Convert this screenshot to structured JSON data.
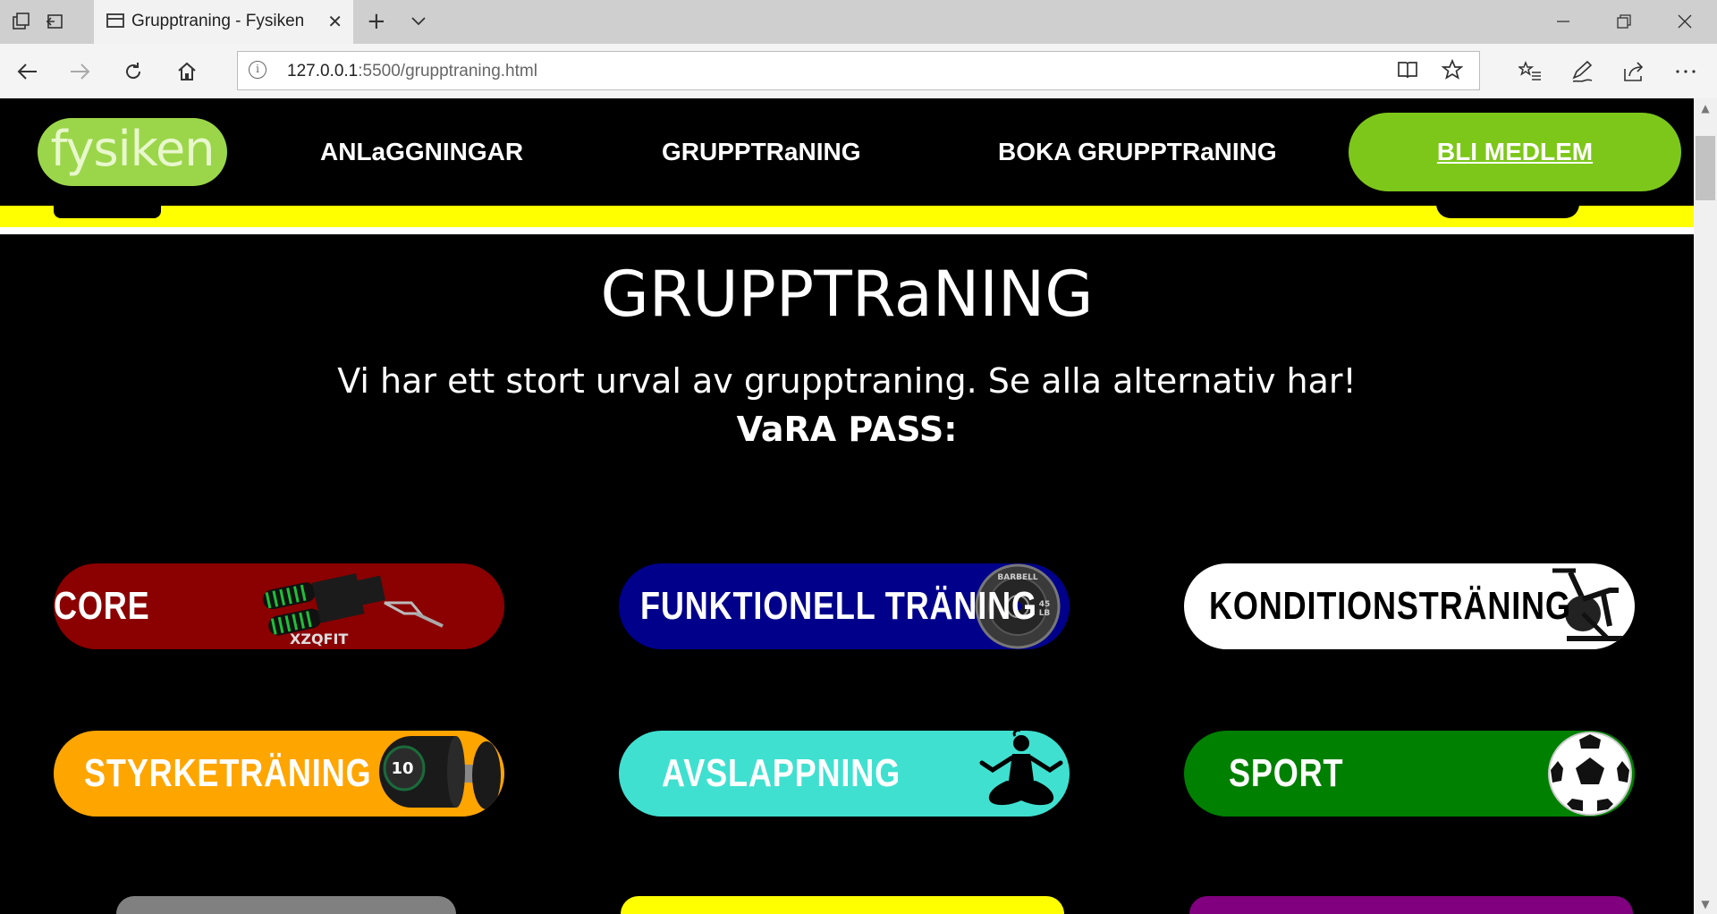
{
  "browser": {
    "tab_title": "Grupptraning - Fysiken",
    "tab_close": "✕",
    "new_tab": "+",
    "url_host": "127.0.0.1",
    "url_path": ":5500/grupptraning.html"
  },
  "site": {
    "logo_text": "fysiken",
    "nav": [
      {
        "label": "ANLaGGNINGAR"
      },
      {
        "label": "GRUPPTRaNING"
      },
      {
        "label": "BOKA GRUPPTRaNING"
      }
    ],
    "cta_label": "BLI MEDLEM"
  },
  "main": {
    "title": "GRUPPTRaNING",
    "intro": "Vi har ett stort urval av grupptraning. Se alla alternativ har!",
    "subhead": "VaRA PASS:"
  },
  "passes": [
    {
      "label": "CORE",
      "bg": "#8b0000",
      "color": "#ffffff",
      "icon": "hand-grip-icon",
      "img_text": "XZQFIT"
    },
    {
      "label": "FUNKTIONELL TRÄNING",
      "bg": "#00008b",
      "color": "#ffffff",
      "icon": "barbell-plate-icon",
      "img_text": "BARBELL"
    },
    {
      "label": "KONDITIONSTRÄNING",
      "bg": "#ffffff",
      "color": "#000000",
      "icon": "exercise-bike-icon"
    },
    {
      "label": "STYRKETRÄNING",
      "bg": "#ffa500",
      "color": "#ffffff",
      "icon": "dumbbell-icon",
      "img_text": "10"
    },
    {
      "label": "AVSLAPPNING",
      "bg": "#40e0d0",
      "color": "#ffffff",
      "icon": "meditation-icon"
    },
    {
      "label": "SPORT",
      "bg": "#008000",
      "color": "#ffffff",
      "icon": "soccer-ball-icon"
    }
  ],
  "colors": {
    "accent_green": "#7dc71a",
    "logo_green": "#9bd64a",
    "band_yellow": "#ffff00"
  }
}
